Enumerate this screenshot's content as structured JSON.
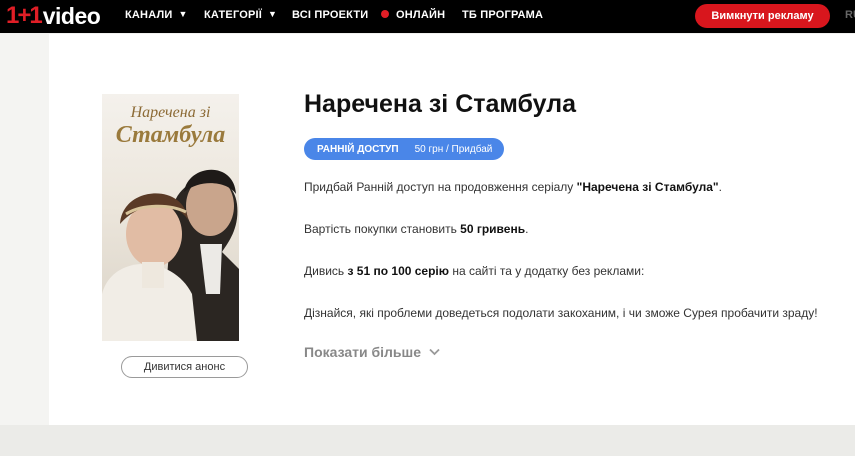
{
  "header": {
    "logo_mark": "1+1",
    "logo_text": "video",
    "nav": {
      "channels": "КАНАЛИ",
      "categories": "КАТЕГОРІЇ",
      "all_projects": "ВСІ ПРОЕКТИ",
      "live": "ОНЛАЙН",
      "tv_program": "ТБ ПРОГРАМА"
    },
    "ads_button": "Вимкнути рекламу",
    "language": "RU"
  },
  "poster": {
    "title_line1": "Наречена зі",
    "title_line2": "Стамбула"
  },
  "trailer_button": "Дивитися анонс",
  "show": {
    "title": "Наречена зі Стамбула",
    "badge_label": "РАННІЙ ДОСТУП",
    "badge_price": "50 грн / Придбай",
    "p1_pre": "Придбай Ранній доступ на продовження серіалу ",
    "p1_bold": "\"Наречена зі Стамбула\"",
    "p1_post": ".",
    "p2_pre": "Вартість покупки становить ",
    "p2_bold": "50 гривень",
    "p2_post": ".",
    "p3_pre": "Дивись ",
    "p3_bold": "з 51 по 100 серію",
    "p3_post": " на сайті та у додатку без реклами:",
    "p4": "Дізнайся, які проблеми доведеться подолати закоханим, і чи зможе Сурея пробачити зраду!",
    "show_more": "Показати більше"
  },
  "colors": {
    "header_bg": "#000000",
    "brand_red": "#e01e26",
    "badge_blue": "#4a86e8"
  }
}
